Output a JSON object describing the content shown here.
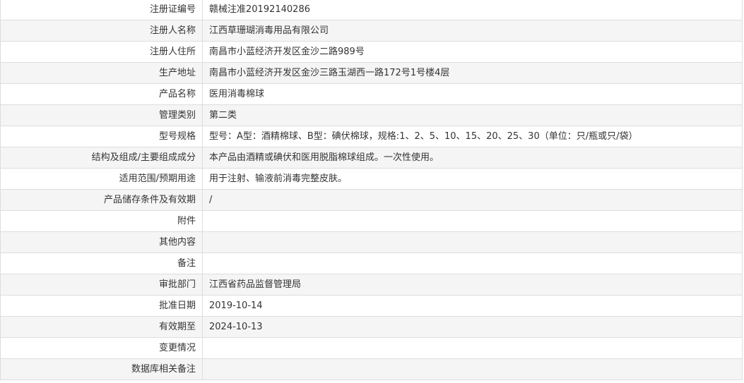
{
  "rows": [
    {
      "label": "注册证编号",
      "value": "赣械注准20192140286"
    },
    {
      "label": "注册人名称",
      "value": "江西草珊瑚消毒用品有限公司"
    },
    {
      "label": "注册人住所",
      "value": "南昌市小蓝经济开发区金沙二路989号"
    },
    {
      "label": "生产地址",
      "value": "南昌市小蓝经济开发区金沙三路玉湖西一路172号1号楼4层"
    },
    {
      "label": "产品名称",
      "value": "医用消毒棉球"
    },
    {
      "label": "管理类别",
      "value": "第二类"
    },
    {
      "label": "型号规格",
      "value": "型号：A型：酒精棉球、B型：碘伏棉球，规格:1、2、5、10、15、20、25、30（单位：只/瓶或只/袋）"
    },
    {
      "label": "结构及组成/主要组成成分",
      "value": "本产品由酒精或碘伏和医用脱脂棉球组成。一次性使用。"
    },
    {
      "label": "适用范围/预期用途",
      "value": "用于注射、输液前消毒完整皮肤。"
    },
    {
      "label": "产品储存条件及有效期",
      "value": "/"
    },
    {
      "label": "附件",
      "value": ""
    },
    {
      "label": "其他内容",
      "value": ""
    },
    {
      "label": "备注",
      "value": ""
    },
    {
      "label": "审批部门",
      "value": "江西省药品监督管理局"
    },
    {
      "label": "批准日期",
      "value": "2019-10-14"
    },
    {
      "label": "有效期至",
      "value": "2024-10-13"
    },
    {
      "label": "变更情况",
      "value": ""
    },
    {
      "label": "数据库相关备注",
      "value": ""
    }
  ]
}
